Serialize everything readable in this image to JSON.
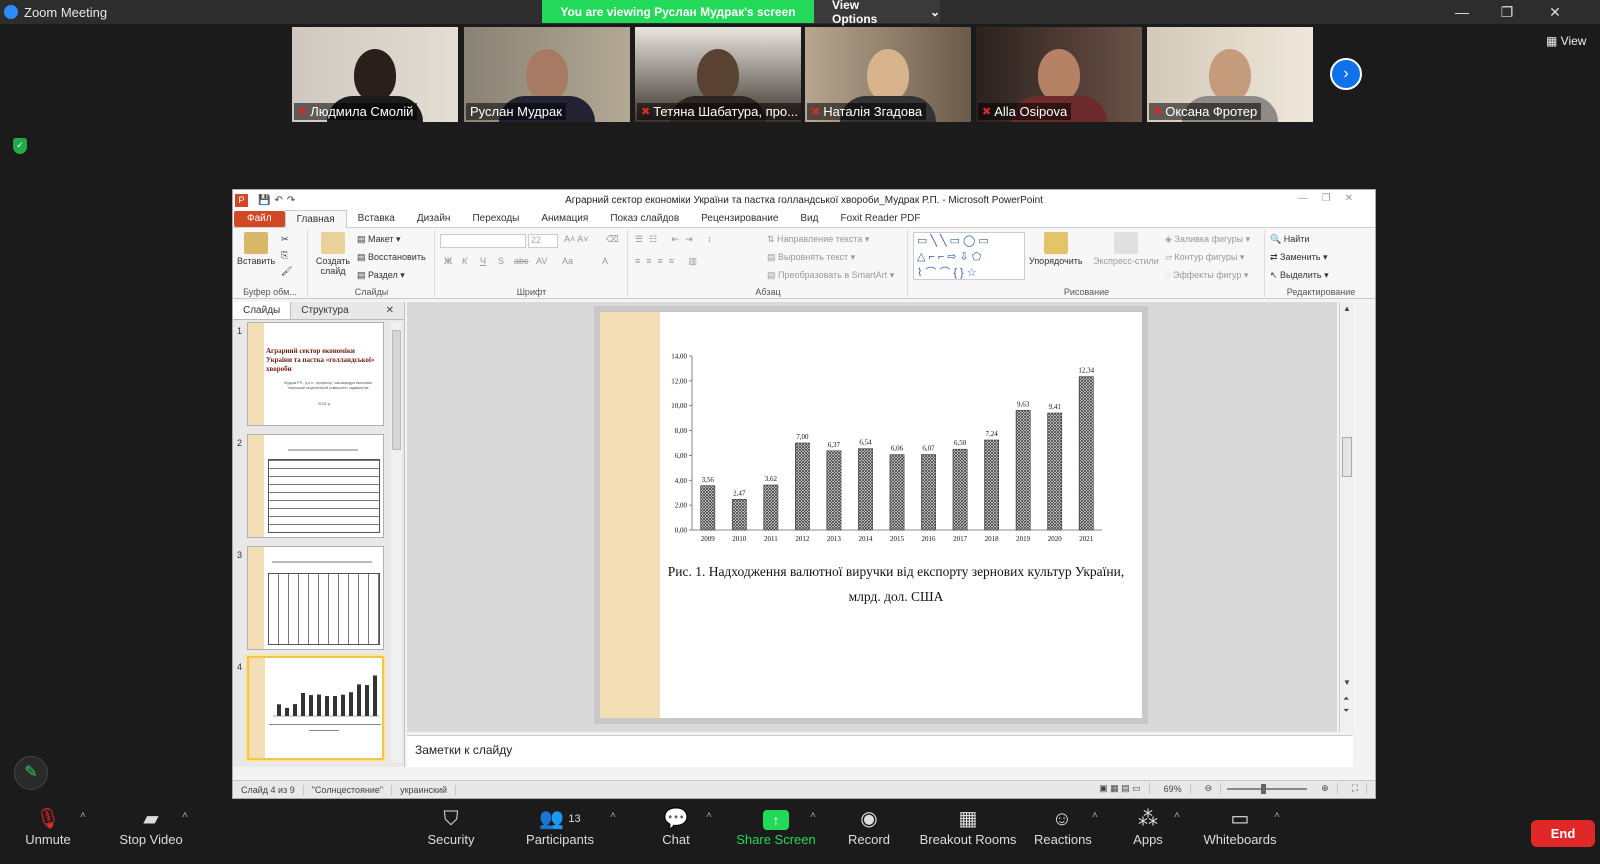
{
  "window": {
    "app_title": "Zoom Meeting",
    "viewing_banner": "You are viewing Руслан Мудрак's screen",
    "view_options": "View Options",
    "view_button": "View"
  },
  "participants": [
    {
      "name": "Людмила Смолій",
      "muted": true
    },
    {
      "name": "Руслан Мудрак",
      "muted": false
    },
    {
      "name": "Тетяна Шабатура, про...",
      "muted": true
    },
    {
      "name": "Наталія Згадова",
      "muted": true
    },
    {
      "name": "Alla Osipova",
      "muted": true
    },
    {
      "name": "Оксана Фротер",
      "muted": true
    }
  ],
  "ppt": {
    "title": "Аграрний сектор економіки України та пастка голландської хвороби_Мудрак Р.П.  -  Microsoft PowerPoint",
    "tabs": [
      "Файл",
      "Главная",
      "Вставка",
      "Дизайн",
      "Переходы",
      "Анимация",
      "Показ слайдов",
      "Рецензирование",
      "Вид",
      "Foxit Reader PDF"
    ],
    "ribbon": {
      "paste": "Вставить",
      "clipboard_group": "Буфер обм...",
      "new_slide": "Создать слайд",
      "layout": "Макет",
      "reset": "Восстановить",
      "section": "Раздел",
      "slides_group": "Слайды",
      "font_size": "22",
      "font_group": "Шрифт",
      "bold": "Ж",
      "italic": "К",
      "underline": "Ч",
      "strike": "S",
      "shadow": "abc",
      "spacing": "AV",
      "case": "Aa",
      "text_direction": "Направление текста",
      "align_text": "Выровнять текст",
      "smartart": "Преобразовать в SmartArt",
      "paragraph_group": "Абзац",
      "arrange": "Упорядочить",
      "quick_styles": "Экспресс-стили",
      "fill": "Заливка фигуры",
      "outline": "Контур фигуры",
      "effects": "Эффекты фигур",
      "drawing_group": "Рисование",
      "find": "Найти",
      "replace": "Заменить",
      "select": "Выделить",
      "editing_group": "Редактирование"
    },
    "panel_tabs": [
      "Слайды",
      "Структура"
    ],
    "thumb1_title": "Аграрний сектор економіки України та пастка «голландської» хвороби",
    "thumb1_author": "Мудрак Р.П., д.е.н., професор, зав.кафедри економіки Уманський національний університет садівництва",
    "thumb1_year": "2021 р.",
    "thumb_slide_numbers": [
      "1",
      "2",
      "3",
      "4"
    ],
    "notes_placeholder": "Заметки к слайду",
    "status": {
      "slide": "Слайд 4 из 9",
      "theme": "\"Солнцестояние\"",
      "language": "украинский",
      "zoom": "69%"
    }
  },
  "chart_data": {
    "type": "bar",
    "categories": [
      "2009",
      "2010",
      "2011",
      "2012",
      "2013",
      "2014",
      "2015",
      "2016",
      "2017",
      "2018",
      "2019",
      "2020",
      "2021"
    ],
    "values": [
      3.56,
      2.47,
      3.62,
      7.0,
      6.37,
      6.54,
      6.06,
      6.07,
      6.5,
      7.24,
      9.63,
      9.41,
      12.34
    ],
    "value_labels": [
      "3,56",
      "2,47",
      "3,62",
      "7,00",
      "6,37",
      "6,54",
      "6,06",
      "6,07",
      "6,50",
      "7,24",
      "9,63",
      "9,41",
      "12,34"
    ],
    "ytick_labels": [
      "0,00",
      "2,00",
      "4,00",
      "6,00",
      "8,00",
      "10,00",
      "12,00",
      "14,00"
    ],
    "ylim": [
      0,
      14
    ],
    "caption_line1": "Рис. 1. Надходження валютної виручки від експорту зернових культур України,",
    "caption_line2": "млрд. дол. США"
  },
  "toolbar": {
    "unmute": "Unmute",
    "stop_video": "Stop Video",
    "security": "Security",
    "participants": "Participants",
    "participants_count": "13",
    "chat": "Chat",
    "share_screen": "Share Screen",
    "record": "Record",
    "breakout_rooms": "Breakout Rooms",
    "reactions": "Reactions",
    "apps": "Apps",
    "whiteboards": "Whiteboards",
    "end": "End"
  },
  "colors": {
    "share_green": "#23d959",
    "end_red": "#e02828",
    "ppt_orange": "#d24726",
    "bar_fill": "#555555",
    "slide_stripe": "#f3deb5"
  }
}
